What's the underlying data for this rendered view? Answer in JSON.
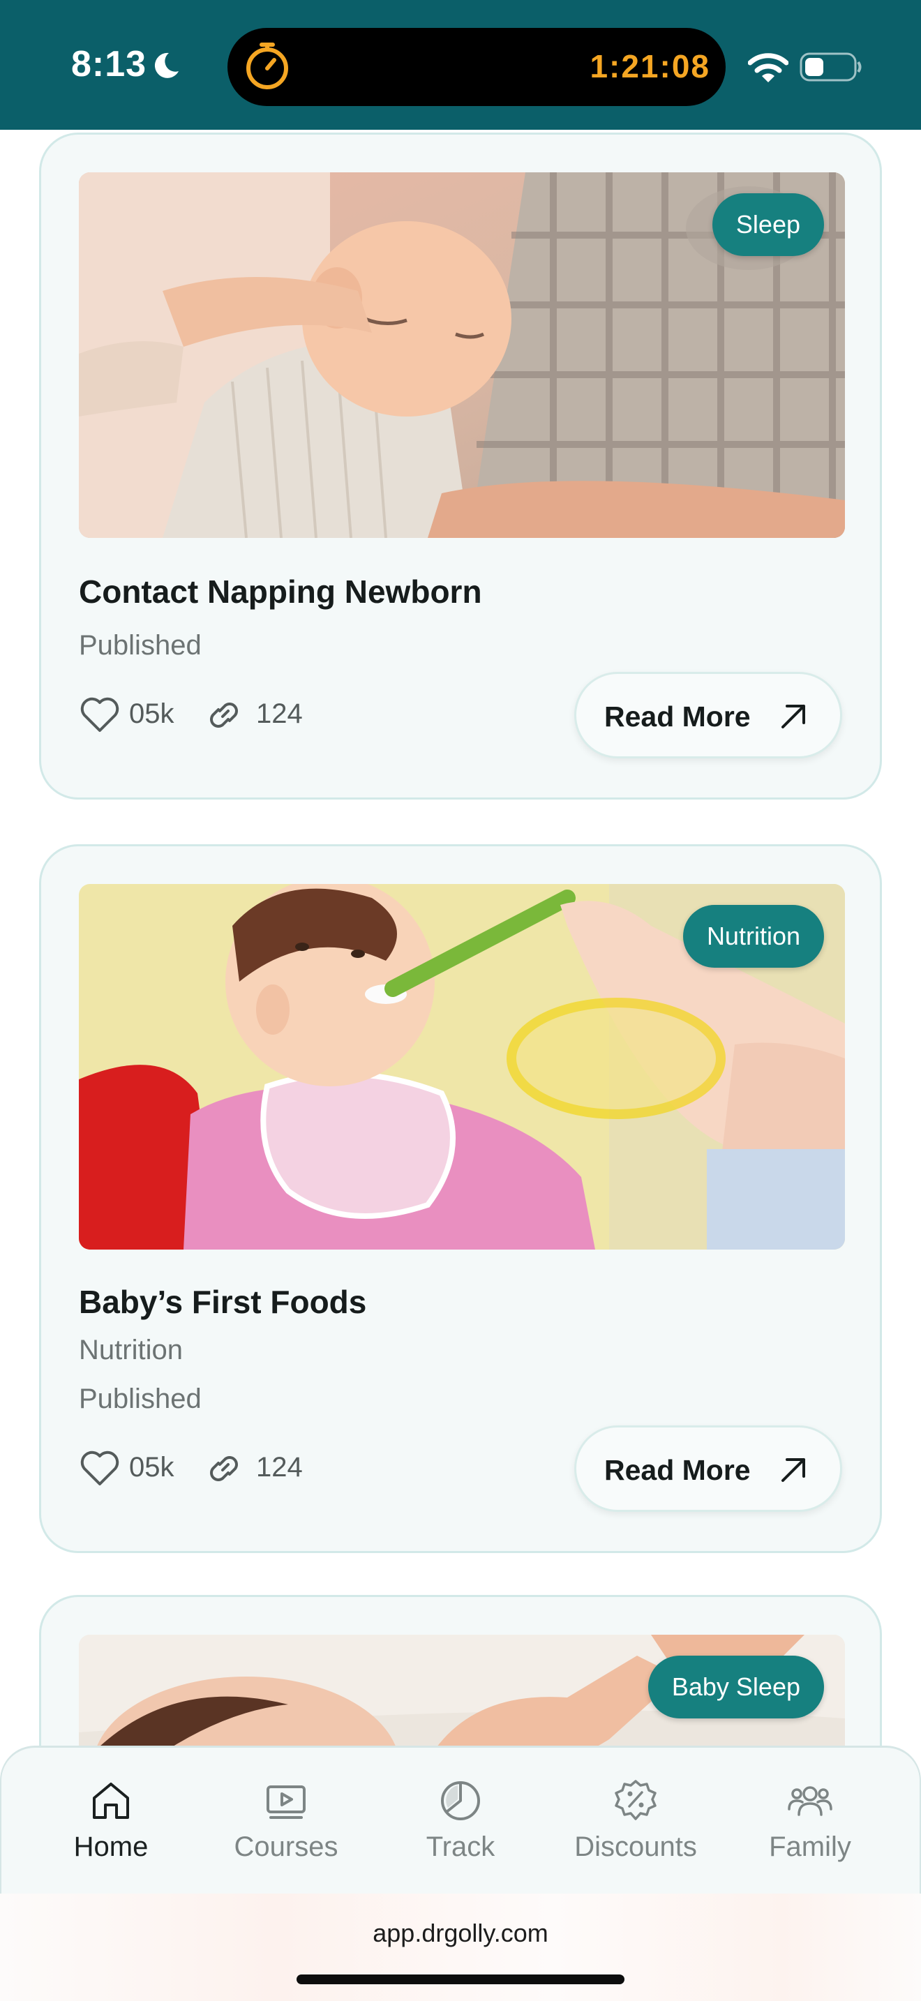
{
  "status_bar": {
    "time": "8:13",
    "timer": "1:21:08",
    "background": "#0b5f69",
    "timer_color": "#f5a623"
  },
  "cards": [
    {
      "tag": "Sleep",
      "title": "Contact Napping Newborn",
      "category": "",
      "status": "Published",
      "likes": "05k",
      "shares": "124",
      "cta": "Read More",
      "image": "parent holding sleeping newborn"
    },
    {
      "tag": "Nutrition",
      "title": "Baby’s First Foods",
      "category": "Nutrition",
      "status": "Published",
      "likes": "05k",
      "shares": "124",
      "cta": "Read More",
      "image": "baby eating from spoon"
    },
    {
      "tag": "Baby Sleep",
      "image": "sleeping newborn (partially visible)"
    }
  ],
  "nav": {
    "items": [
      {
        "label": "Home",
        "icon": "home-icon",
        "active": true
      },
      {
        "label": "Courses",
        "icon": "video-icon",
        "active": false
      },
      {
        "label": "Track",
        "icon": "pie-chart-icon",
        "active": false
      },
      {
        "label": "Discounts",
        "icon": "discount-badge-icon",
        "active": false
      },
      {
        "label": "Family",
        "icon": "family-icon",
        "active": false
      }
    ]
  },
  "browser": {
    "url": "app.drgolly.com"
  },
  "colors": {
    "accent": "#16807f",
    "card_bg": "#f4f9f9",
    "card_border": "#d2e9e8"
  }
}
